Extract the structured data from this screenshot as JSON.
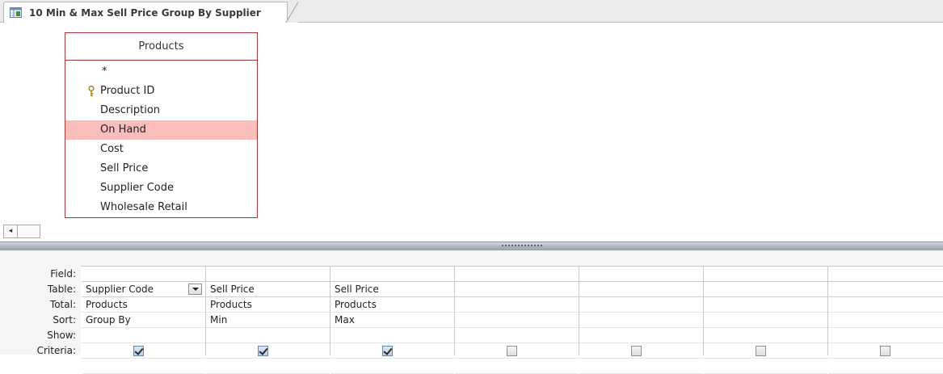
{
  "tab": {
    "title": "10 Min & Max Sell Price Group By Supplier",
    "icon": "query-icon"
  },
  "field_list": {
    "table_name": "Products",
    "items": [
      {
        "label": "*",
        "primary_key": false,
        "selected": false
      },
      {
        "label": "Product ID",
        "primary_key": true,
        "selected": false
      },
      {
        "label": "Description",
        "primary_key": false,
        "selected": false
      },
      {
        "label": "On Hand",
        "primary_key": false,
        "selected": true
      },
      {
        "label": "Cost",
        "primary_key": false,
        "selected": false
      },
      {
        "label": "Sell Price",
        "primary_key": false,
        "selected": false
      },
      {
        "label": "Supplier Code",
        "primary_key": false,
        "selected": false
      },
      {
        "label": "Wholesale Retail",
        "primary_key": false,
        "selected": false
      }
    ],
    "selected_color": "#fbbcbc",
    "border_color": "#a33737"
  },
  "scrollbar": {
    "left_arrow": "◂"
  },
  "grid": {
    "row_labels": {
      "field": "Field:",
      "table": "Table:",
      "total": "Total:",
      "sort": "Sort:",
      "show": "Show:",
      "criteria": "Criteria:"
    },
    "columns": [
      {
        "field": "Supplier Code",
        "table": "Products",
        "total": "Group By",
        "sort": "",
        "show": true,
        "has_dropdown": true
      },
      {
        "field": "Sell Price",
        "table": "Products",
        "total": "Min",
        "sort": "",
        "show": true,
        "has_dropdown": false
      },
      {
        "field": "Sell Price",
        "table": "Products",
        "total": "Max",
        "sort": "",
        "show": true,
        "has_dropdown": false
      },
      {
        "field": "",
        "table": "",
        "total": "",
        "sort": "",
        "show": false,
        "has_dropdown": false
      },
      {
        "field": "",
        "table": "",
        "total": "",
        "sort": "",
        "show": false,
        "has_dropdown": false
      },
      {
        "field": "",
        "table": "",
        "total": "",
        "sort": "",
        "show": false,
        "has_dropdown": false
      },
      {
        "field": "",
        "table": "",
        "total": "",
        "sort": "",
        "show": false,
        "has_dropdown": false
      }
    ]
  }
}
